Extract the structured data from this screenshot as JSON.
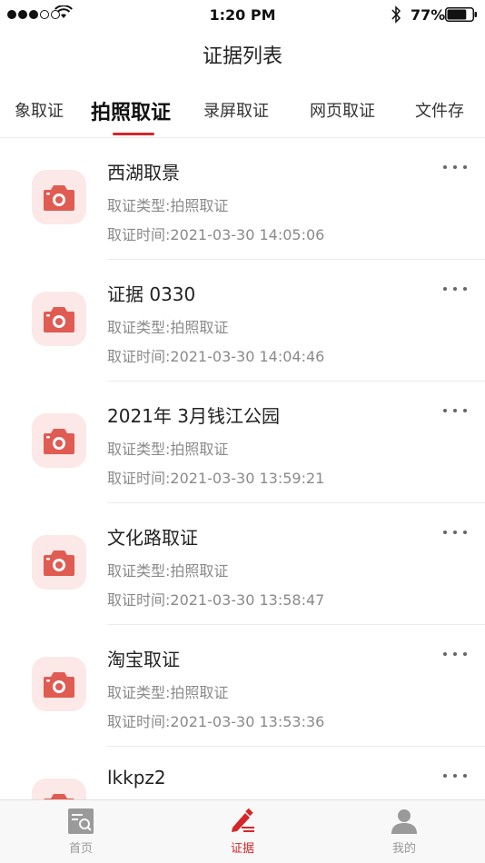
{
  "status_bar": {
    "time": "1:20 PM",
    "battery": "77%",
    "battery_level": 0.77
  },
  "header": {
    "title": "证据列表"
  },
  "tabs": [
    {
      "label": "象取证"
    },
    {
      "label": "拍照取证",
      "active": true
    },
    {
      "label": "录屏取证"
    },
    {
      "label": "网页取证"
    },
    {
      "label": "文件存"
    }
  ],
  "evidence": [
    {
      "title": "西湖取景",
      "type": "取证类型:拍照取证",
      "time": "取证时间:2021-03-30  14:05:06",
      "icon": "camera-icon"
    },
    {
      "title": "证据 0330",
      "type": "取证类型:拍照取证",
      "time": "取证时间:2021-03-30  14:04:46",
      "icon": "camera-icon"
    },
    {
      "title": "2021年 3月钱江公园",
      "type": "取证类型:拍照取证",
      "time": "取证时间:2021-03-30  13:59:21",
      "icon": "camera-icon"
    },
    {
      "title": "文化路取证",
      "type": "取证类型:拍照取证",
      "time": "取证时间:2021-03-30  13:58:47",
      "icon": "camera-icon"
    },
    {
      "title": "淘宝取证",
      "type": "取证类型:拍照取证",
      "time": "取证时间:2021-03-30  13:53:36",
      "icon": "camera-icon"
    },
    {
      "title": "lkkpz2",
      "type": "",
      "time": "",
      "icon": "camera-icon"
    }
  ],
  "tabbar": [
    {
      "label": "首页",
      "icon": "home-search-icon"
    },
    {
      "label": "证据",
      "icon": "pen-edit-icon",
      "active": true
    },
    {
      "label": "我的",
      "icon": "user-icon"
    }
  ],
  "colors": {
    "accent": "#d7262a",
    "icon_bg": "#fbe8e7",
    "camera": "#e05b52"
  }
}
